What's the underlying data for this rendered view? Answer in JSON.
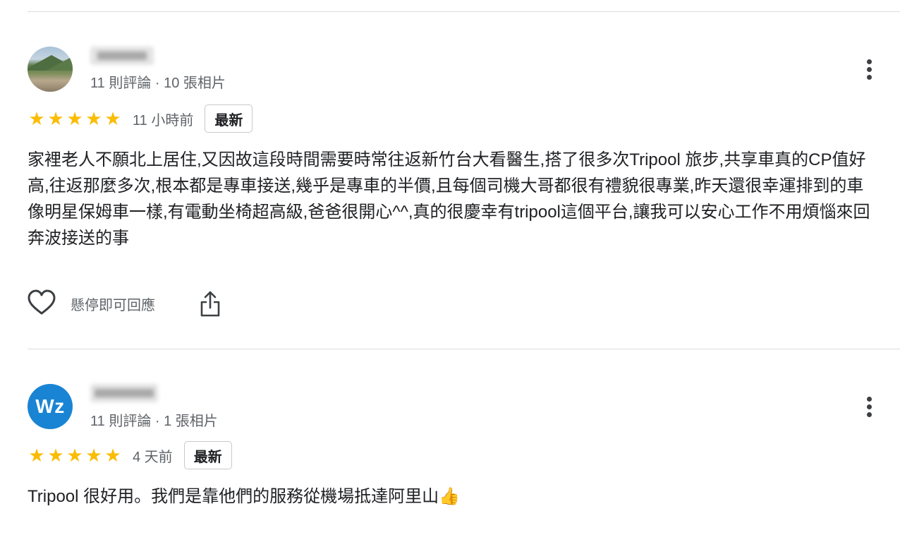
{
  "reviews": [
    {
      "avatar_initials": "",
      "meta": "11 則評論 · 10 張相片",
      "stars": "★★★★★",
      "time": "11 小時前",
      "badge": "最新",
      "text": "家裡老人不願北上居住,又因故這段時間需要時常往返新竹台大看醫生,搭了很多次Tripool 旅步,共享車真的CP值好高,往返那麼多次,根本都是專車接送,幾乎是專車的半價,且每個司機大哥都很有禮貌很專業,昨天還很幸運排到的車像明星保姆車一樣,有電動坐椅超高級,爸爸很開心^^,真的很慶幸有tripool這個平台,讓我可以安心工作不用煩惱來回奔波接送的事",
      "like_label": "懸停即可回應",
      "rating": 5
    },
    {
      "avatar_initials": "Wz",
      "meta": "11 則評論 · 1 張相片",
      "stars": "★★★★★",
      "time": "4 天前",
      "badge": "最新",
      "text": "Tripool 很好用。我們是靠他們的服務從機場抵達阿里山👍",
      "rating": 5
    }
  ],
  "colors": {
    "star": "#fbbc04",
    "avatar_blue": "#1a84d4",
    "secondary_text": "#5f6368",
    "divider": "#dadce0"
  },
  "icons": [
    "more-vert-icon",
    "heart-outline-icon",
    "share-icon",
    "star-icon"
  ]
}
